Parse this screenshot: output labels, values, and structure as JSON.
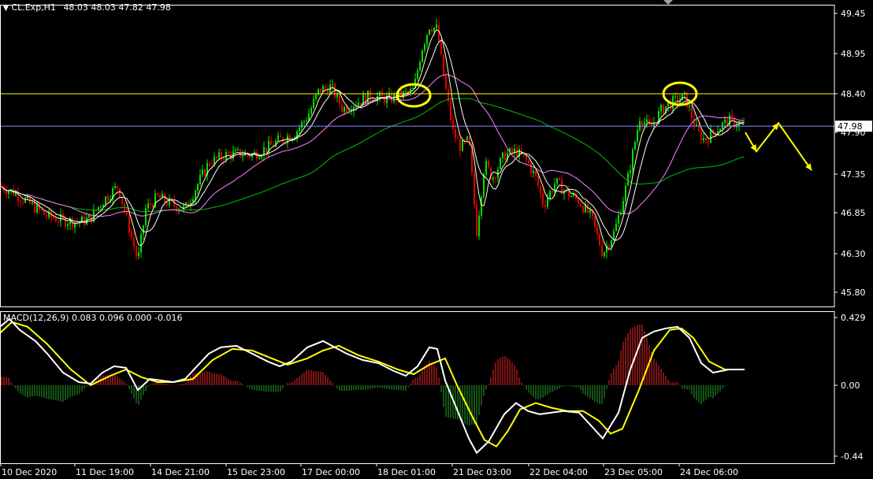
{
  "header": {
    "symbol": "CL.Exp,H1",
    "ohlc": "48.03 48.03 47.82 47.98",
    "macd_label": "MACD(12,26,9) 0.083 0.096 0.000 -0.016"
  },
  "colors": {
    "background": "#000000",
    "frame": "#ffffff",
    "bull": "#00e000",
    "bear": "#e00000",
    "ma_fast": "#ffffcc",
    "ma_mid": "#ffffff",
    "ma_slow": "#ff80ff",
    "ma_long": "#00c000",
    "resistance": "#ffff00",
    "bid_line": "#8888ff",
    "macd_line": "#ffffff",
    "signal_line": "#ffff00",
    "hist_pos": "#cc2222",
    "hist_neg": "#228822",
    "annotation": "#ffff00"
  },
  "chart_data": {
    "type": "candlestick",
    "symbol": "CL.Exp,H1",
    "price_axis": {
      "ticks": [
        "49.45",
        "48.95",
        "48.40",
        "47.90",
        "47.35",
        "46.85",
        "46.30",
        "45.80"
      ],
      "ylim": [
        45.69,
        49.6
      ],
      "current_price": "47.98"
    },
    "resistance_level": 48.4,
    "time_axis": [
      "10 Dec 2020",
      "11 Dec 19:00",
      "14 Dec 21:00",
      "15 Dec 23:00",
      "17 Dec 00:00",
      "18 Dec 01:00",
      "21 Dec 03:00",
      "22 Dec 04:00",
      "23 Dec 05:00",
      "24 Dec 06:00"
    ],
    "price_path": [
      [
        0,
        47.2
      ],
      [
        20,
        47.1
      ],
      [
        40,
        46.95
      ],
      [
        60,
        46.8
      ],
      [
        80,
        46.75
      ],
      [
        100,
        46.72
      ],
      [
        115,
        46.78
      ],
      [
        130,
        47.0
      ],
      [
        150,
        47.2
      ],
      [
        165,
        46.6
      ],
      [
        175,
        46.2
      ],
      [
        185,
        46.9
      ],
      [
        200,
        47.05
      ],
      [
        220,
        46.95
      ],
      [
        235,
        46.9
      ],
      [
        250,
        47.2
      ],
      [
        265,
        47.5
      ],
      [
        285,
        47.6
      ],
      [
        305,
        47.62
      ],
      [
        320,
        47.6
      ],
      [
        340,
        47.7
      ],
      [
        355,
        47.8
      ],
      [
        375,
        47.9
      ],
      [
        390,
        48.1
      ],
      [
        405,
        48.45
      ],
      [
        420,
        48.5
      ],
      [
        435,
        48.2
      ],
      [
        455,
        48.3
      ],
      [
        470,
        48.38
      ],
      [
        490,
        48.33
      ],
      [
        510,
        48.38
      ],
      [
        525,
        48.45
      ],
      [
        535,
        49.0
      ],
      [
        545,
        49.3
      ],
      [
        555,
        49.25
      ],
      [
        565,
        48.5
      ],
      [
        575,
        47.9
      ],
      [
        585,
        47.7
      ],
      [
        595,
        47.8
      ],
      [
        605,
        46.6
      ],
      [
        615,
        47.5
      ],
      [
        625,
        47.3
      ],
      [
        640,
        47.6
      ],
      [
        655,
        47.65
      ],
      [
        670,
        47.5
      ],
      [
        680,
        47.3
      ],
      [
        690,
        46.95
      ],
      [
        705,
        47.25
      ],
      [
        720,
        47.1
      ],
      [
        735,
        47.0
      ],
      [
        750,
        46.8
      ],
      [
        765,
        46.3
      ],
      [
        780,
        46.6
      ],
      [
        795,
        47.2
      ],
      [
        812,
        48.1
      ],
      [
        825,
        47.95
      ],
      [
        840,
        48.2
      ],
      [
        855,
        48.3
      ],
      [
        870,
        48.35
      ],
      [
        885,
        47.9
      ],
      [
        895,
        47.8
      ],
      [
        910,
        47.95
      ],
      [
        925,
        48.05
      ],
      [
        945,
        47.98
      ]
    ],
    "forecast_path": [
      [
        946,
        47.9
      ],
      [
        960,
        47.65
      ],
      [
        988,
        48.02
      ],
      [
        1030,
        47.4
      ]
    ],
    "highlight_circles": [
      {
        "x": 525,
        "price": 48.38
      },
      {
        "x": 863,
        "price": 48.4
      }
    ],
    "macd": {
      "label": "MACD(12,26,9) 0.083 0.096 0.000 -0.016",
      "ticks": [
        "0.429",
        "0.00",
        "-0.44"
      ],
      "ylim": [
        -0.44,
        0.429
      ],
      "main_path": [
        [
          0,
          0.37
        ],
        [
          12,
          0.42
        ],
        [
          25,
          0.35
        ],
        [
          45,
          0.28
        ],
        [
          60,
          0.2
        ],
        [
          80,
          0.08
        ],
        [
          100,
          0.02
        ],
        [
          115,
          0.01
        ],
        [
          130,
          0.08
        ],
        [
          145,
          0.12
        ],
        [
          160,
          0.11
        ],
        [
          175,
          -0.03
        ],
        [
          190,
          0.04
        ],
        [
          205,
          0.03
        ],
        [
          220,
          0.02
        ],
        [
          235,
          0.04
        ],
        [
          250,
          0.12
        ],
        [
          265,
          0.2
        ],
        [
          280,
          0.24
        ],
        [
          300,
          0.25
        ],
        [
          320,
          0.2
        ],
        [
          340,
          0.15
        ],
        [
          355,
          0.12
        ],
        [
          370,
          0.15
        ],
        [
          390,
          0.24
        ],
        [
          410,
          0.28
        ],
        [
          425,
          0.24
        ],
        [
          440,
          0.2
        ],
        [
          460,
          0.16
        ],
        [
          480,
          0.14
        ],
        [
          500,
          0.09
        ],
        [
          515,
          0.06
        ],
        [
          530,
          0.12
        ],
        [
          545,
          0.24
        ],
        [
          555,
          0.23
        ],
        [
          565,
          0.03
        ],
        [
          580,
          -0.15
        ],
        [
          595,
          -0.33
        ],
        [
          605,
          -0.42
        ],
        [
          620,
          -0.35
        ],
        [
          640,
          -0.18
        ],
        [
          655,
          -0.11
        ],
        [
          670,
          -0.16
        ],
        [
          685,
          -0.18
        ],
        [
          700,
          -0.17
        ],
        [
          715,
          -0.16
        ],
        [
          735,
          -0.17
        ],
        [
          750,
          -0.25
        ],
        [
          765,
          -0.33
        ],
        [
          785,
          -0.17
        ],
        [
          800,
          0.1
        ],
        [
          815,
          0.3
        ],
        [
          830,
          0.34
        ],
        [
          845,
          0.36
        ],
        [
          860,
          0.37
        ],
        [
          875,
          0.3
        ],
        [
          890,
          0.14
        ],
        [
          905,
          0.08
        ],
        [
          925,
          0.1
        ],
        [
          945,
          0.1
        ]
      ],
      "signal_path": [
        [
          0,
          0.33
        ],
        [
          15,
          0.4
        ],
        [
          35,
          0.37
        ],
        [
          60,
          0.26
        ],
        [
          90,
          0.1
        ],
        [
          115,
          0.0
        ],
        [
          140,
          0.06
        ],
        [
          160,
          0.1
        ],
        [
          180,
          0.05
        ],
        [
          200,
          0.02
        ],
        [
          220,
          0.02
        ],
        [
          245,
          0.04
        ],
        [
          270,
          0.16
        ],
        [
          295,
          0.23
        ],
        [
          320,
          0.22
        ],
        [
          345,
          0.17
        ],
        [
          365,
          0.13
        ],
        [
          390,
          0.17
        ],
        [
          410,
          0.22
        ],
        [
          430,
          0.25
        ],
        [
          455,
          0.19
        ],
        [
          480,
          0.15
        ],
        [
          505,
          0.1
        ],
        [
          525,
          0.07
        ],
        [
          545,
          0.13
        ],
        [
          565,
          0.17
        ],
        [
          580,
          0.0
        ],
        [
          600,
          -0.2
        ],
        [
          615,
          -0.34
        ],
        [
          630,
          -0.38
        ],
        [
          645,
          -0.28
        ],
        [
          660,
          -0.15
        ],
        [
          680,
          -0.11
        ],
        [
          700,
          -0.14
        ],
        [
          720,
          -0.16
        ],
        [
          740,
          -0.16
        ],
        [
          760,
          -0.22
        ],
        [
          775,
          -0.3
        ],
        [
          790,
          -0.27
        ],
        [
          810,
          -0.04
        ],
        [
          830,
          0.22
        ],
        [
          850,
          0.35
        ],
        [
          865,
          0.36
        ],
        [
          880,
          0.3
        ],
        [
          900,
          0.15
        ],
        [
          920,
          0.1
        ],
        [
          945,
          0.1
        ]
      ]
    }
  }
}
